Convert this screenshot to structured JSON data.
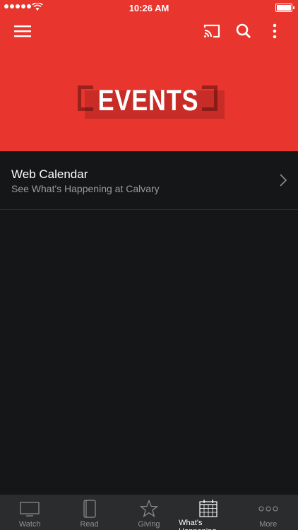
{
  "status_bar": {
    "time": "10:26 AM"
  },
  "banner": {
    "text": "EVENTS"
  },
  "list": {
    "items": [
      {
        "title": "Web Calendar",
        "subtitle": "See What's Happening at Calvary"
      }
    ]
  },
  "tabbar": {
    "tabs": [
      {
        "label": "Watch",
        "icon": "tv-icon",
        "active": false
      },
      {
        "label": "Read",
        "icon": "book-icon",
        "active": false
      },
      {
        "label": "Giving",
        "icon": "star-icon",
        "active": false
      },
      {
        "label": "What's Happening",
        "icon": "calendar-icon",
        "active": true
      },
      {
        "label": "More",
        "icon": "more-dots-icon",
        "active": false
      }
    ]
  },
  "colors": {
    "header_bg": "#e8352d",
    "body_bg": "#151618",
    "tabbar_bg": "#2b2c2e"
  }
}
